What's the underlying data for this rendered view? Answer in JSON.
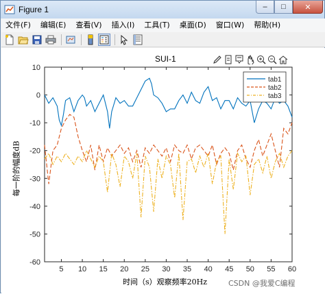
{
  "window": {
    "title": "Figure 1",
    "controls": {
      "minimize": "–",
      "maximize": "□",
      "close": "✕"
    }
  },
  "menu": [
    "文件(F)",
    "编辑(E)",
    "查看(V)",
    "插入(I)",
    "工具(T)",
    "桌面(D)",
    "窗口(W)",
    "帮助(H)"
  ],
  "toolbar_icons": [
    "new-figure-icon",
    "open-file-icon",
    "save-icon",
    "print-icon",
    "link-plot-icon",
    "insert-colorbar-icon",
    "insert-legend-icon",
    "edit-plot-icon",
    "property-inspector-icon"
  ],
  "axes_toolbar_icons": [
    "brush-icon",
    "export-icon",
    "datatip-icon",
    "pan-icon",
    "zoom-in-icon",
    "zoom-out-icon",
    "home-icon"
  ],
  "chart_data": {
    "type": "line",
    "title": "SUI-1",
    "xlabel": "时间（s）观察频率20Hz",
    "ylabel": "每一阶的幅度dB",
    "xlim": [
      1,
      60
    ],
    "ylim": [
      -60,
      10
    ],
    "xticks": [
      5,
      10,
      15,
      20,
      25,
      30,
      35,
      40,
      45,
      50,
      55,
      60
    ],
    "yticks": [
      10,
      0,
      -10,
      -20,
      -30,
      -40,
      -50,
      -60
    ],
    "legend_position": "top-right",
    "colors": {
      "tab1": "#0072bd",
      "tab2": "#d95319",
      "tab3": "#edb120"
    },
    "series": [
      {
        "name": "tab1",
        "style": "solid",
        "x": [
          1,
          2,
          3,
          4,
          4.5,
          5,
          5.5,
          6,
          7,
          8,
          9,
          10,
          10.5,
          11,
          12,
          13,
          14,
          15,
          16,
          16.5,
          17,
          18,
          19,
          20,
          21,
          22,
          23,
          24,
          25,
          26,
          26.5,
          27,
          28,
          29,
          30,
          31,
          32,
          33,
          34,
          35,
          36,
          37,
          38,
          39,
          40,
          41,
          42,
          43,
          44,
          45,
          46,
          47,
          48,
          49,
          50,
          51,
          52,
          53,
          54,
          55,
          56,
          57,
          58,
          59,
          60
        ],
        "y": [
          0,
          -3,
          -1,
          -4,
          -9,
          -11,
          -7,
          -2,
          -1,
          -6,
          -2,
          0,
          -1,
          -4,
          -2,
          -6,
          -3,
          0,
          -6,
          -12,
          -6,
          -1,
          -3,
          -2,
          -4,
          -4,
          -1,
          2,
          5,
          6,
          4,
          0,
          -1,
          -3,
          -6,
          -5,
          -5,
          -2,
          0,
          -3,
          1,
          -2,
          -3,
          1,
          3,
          -2,
          -1,
          -5,
          -2,
          -2,
          -5,
          -1,
          -3,
          -4,
          -2,
          -10,
          -5,
          -2,
          -3,
          -5,
          -1,
          -3,
          -2,
          -4,
          -8
        ]
      },
      {
        "name": "tab2",
        "style": "dashed",
        "x": [
          1,
          2,
          3,
          4,
          5,
          6,
          7,
          8,
          9,
          10,
          11,
          12,
          13,
          14,
          15,
          16,
          17,
          18,
          19,
          20,
          21,
          22,
          23,
          24,
          25,
          26,
          27,
          28,
          29,
          30,
          31,
          32,
          33,
          34,
          35,
          36,
          37,
          38,
          39,
          40,
          41,
          42,
          43,
          44,
          45,
          46,
          47,
          48,
          49,
          50,
          51,
          52,
          53,
          54,
          55,
          56,
          57,
          58,
          59,
          60
        ],
        "y": [
          -18,
          -32,
          -20,
          -18,
          -12,
          -9,
          -7,
          -8,
          -15,
          -20,
          -24,
          -18,
          -27,
          -18,
          -24,
          -19,
          -22,
          -20,
          -18,
          -21,
          -19,
          -24,
          -20,
          -26,
          -19,
          -21,
          -18,
          -20,
          -22,
          -19,
          -24,
          -18,
          -20,
          -21,
          -18,
          -23,
          -19,
          -18,
          -20,
          -22,
          -18,
          -25,
          -21,
          -19,
          -21,
          -27,
          -20,
          -18,
          -23,
          -26,
          -20,
          -16,
          -22,
          -18,
          -14,
          -20,
          -26,
          -12,
          -14,
          -10
        ]
      },
      {
        "name": "tab3",
        "style": "dashdot",
        "x": [
          1,
          2,
          3,
          4,
          5,
          6,
          7,
          8,
          9,
          10,
          11,
          12,
          13,
          14,
          15,
          16,
          17,
          18,
          19,
          20,
          21,
          22,
          23,
          24,
          25,
          26,
          27,
          28,
          29,
          30,
          31,
          32,
          33,
          34,
          35,
          36,
          37,
          38,
          39,
          40,
          41,
          42,
          43,
          44,
          45,
          46,
          47,
          48,
          49,
          50,
          51,
          52,
          53,
          54,
          55,
          56,
          57,
          58,
          59,
          60
        ],
        "y": [
          -23,
          -21,
          -25,
          -22,
          -24,
          -21,
          -23,
          -25,
          -22,
          -24,
          -20,
          -23,
          -26,
          -22,
          -24,
          -35,
          -21,
          -25,
          -33,
          -22,
          -24,
          -30,
          -21,
          -44,
          -22,
          -26,
          -42,
          -23,
          -30,
          -22,
          -25,
          -37,
          -21,
          -45,
          -24,
          -23,
          -28,
          -22,
          -26,
          -21,
          -32,
          -24,
          -22,
          -50,
          -23,
          -34,
          -21,
          -24,
          -22,
          -36,
          -25,
          -23,
          -28,
          -22,
          -30,
          -24,
          -21,
          -26,
          -22,
          -20
        ]
      }
    ]
  },
  "watermark": "CSDN @我爱C编程"
}
